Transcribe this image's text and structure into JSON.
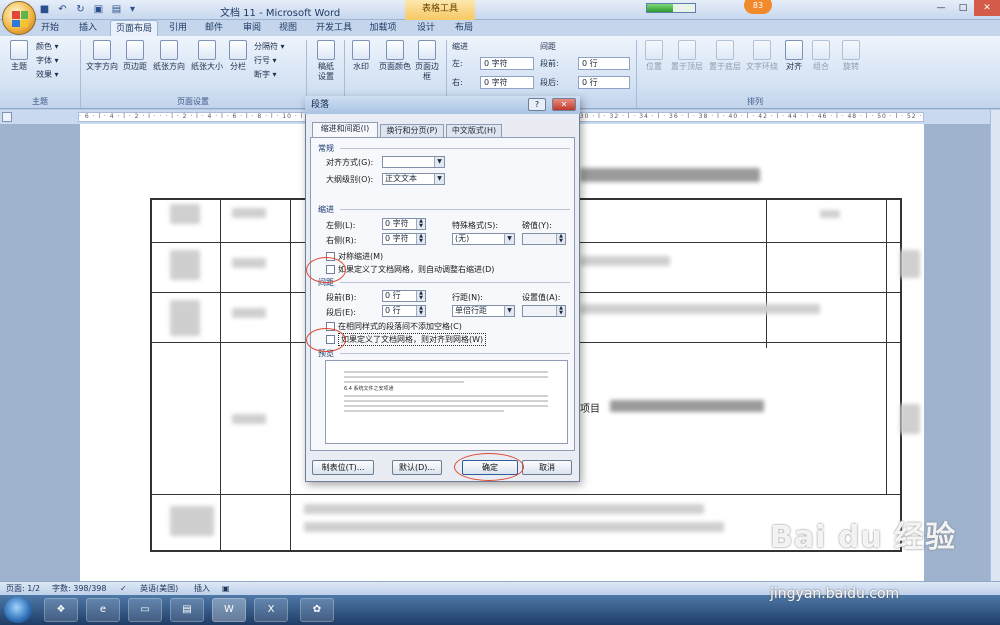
{
  "window": {
    "title": "文档 11 - Microsoft Word",
    "context_tab": "表格工具",
    "progress_fraction": 0.55,
    "notification_badge": "83",
    "controls": [
      "—",
      "□",
      "✕"
    ]
  },
  "ribbon_tabs": [
    "开始",
    "插入",
    "页面布局",
    "引用",
    "邮件",
    "审阅",
    "视图",
    "开发工具",
    "加载项",
    "设计",
    "布局"
  ],
  "active_tab": "页面布局",
  "ribbon": {
    "theme": {
      "big": "主题",
      "small": [
        "颜色 ▾",
        "字体 ▾",
        "效果 ▾"
      ],
      "group": "主题"
    },
    "page_setup": {
      "buttons": [
        "文字方向",
        "页边距",
        "纸张方向",
        "纸张大小",
        "分栏"
      ],
      "small": [
        "分隔符 ▾",
        "行号 ▾",
        "断字 ▾"
      ],
      "group": "页面设置"
    },
    "manuscript": {
      "label1": "稿纸",
      "label2": "设置"
    },
    "page_background": {
      "buttons": [
        "水印",
        "页面颜色",
        "页面边框"
      ],
      "border_line2": "边框"
    },
    "paragraph": {
      "indent_title": "缩进",
      "spacing_title": "间距",
      "left_label": "左:",
      "right_label": "右:",
      "before_label": "段前:",
      "after_label": "段后:",
      "left_value": "0 字符",
      "right_value": "0 字符",
      "before_value": "0 行",
      "after_value": "0 行"
    },
    "arrange": {
      "buttons": [
        "位置",
        "置于顶层",
        "置于底层",
        "文字环绕",
        "对齐",
        "组合",
        "旋转"
      ],
      "group": "排列"
    }
  },
  "statusbar": {
    "page": "页面: 1/2",
    "words": "字数: 398/398",
    "language": "英语(美国)",
    "mode": "插入"
  },
  "dialog": {
    "title": "段落",
    "help": "?",
    "close": "✕",
    "tabs": [
      "缩进和间距(I)",
      "换行和分页(P)",
      "中文版式(H)"
    ],
    "general": {
      "title": "常规",
      "alignment_label": "对齐方式(G):",
      "alignment_value": "",
      "outline_label": "大纲级别(O):",
      "outline_value": "正文文本"
    },
    "indent": {
      "title": "缩进",
      "left_label": "左侧(L):",
      "left_value": "0 字符",
      "right_label": "右侧(R):",
      "right_value": "0 字符",
      "special_label": "特殊格式(S):",
      "special_value": "(无)",
      "by_label": "磅值(Y):",
      "mirror_label": "对称缩进(M)",
      "auto_adjust_label": "如果定义了文档网格，则自动调整右缩进(D)"
    },
    "spacing": {
      "title": "间距",
      "before_label": "段前(B):",
      "before_value": "0 行",
      "after_label": "段后(E):",
      "after_value": "0 行",
      "line_label": "行距(N):",
      "line_value": "单倍行距",
      "at_label": "设置值(A):",
      "no_space_label": "在相同样式的段落间不添加空格(C)",
      "snap_grid_label": "如果定义了文档网格，则对齐到网格(W)"
    },
    "preview": {
      "title": "预览",
      "sample": "6.4 系统文件之安项通"
    },
    "buttons": {
      "tabs": "制表位(T)...",
      "default": "默认(D)...",
      "ok": "确定",
      "cancel": "取消"
    }
  },
  "document": {
    "visible_fragment": "项目"
  },
  "watermark": {
    "logo": "Bai du 经验",
    "url": "jingyan.baidu.com"
  }
}
